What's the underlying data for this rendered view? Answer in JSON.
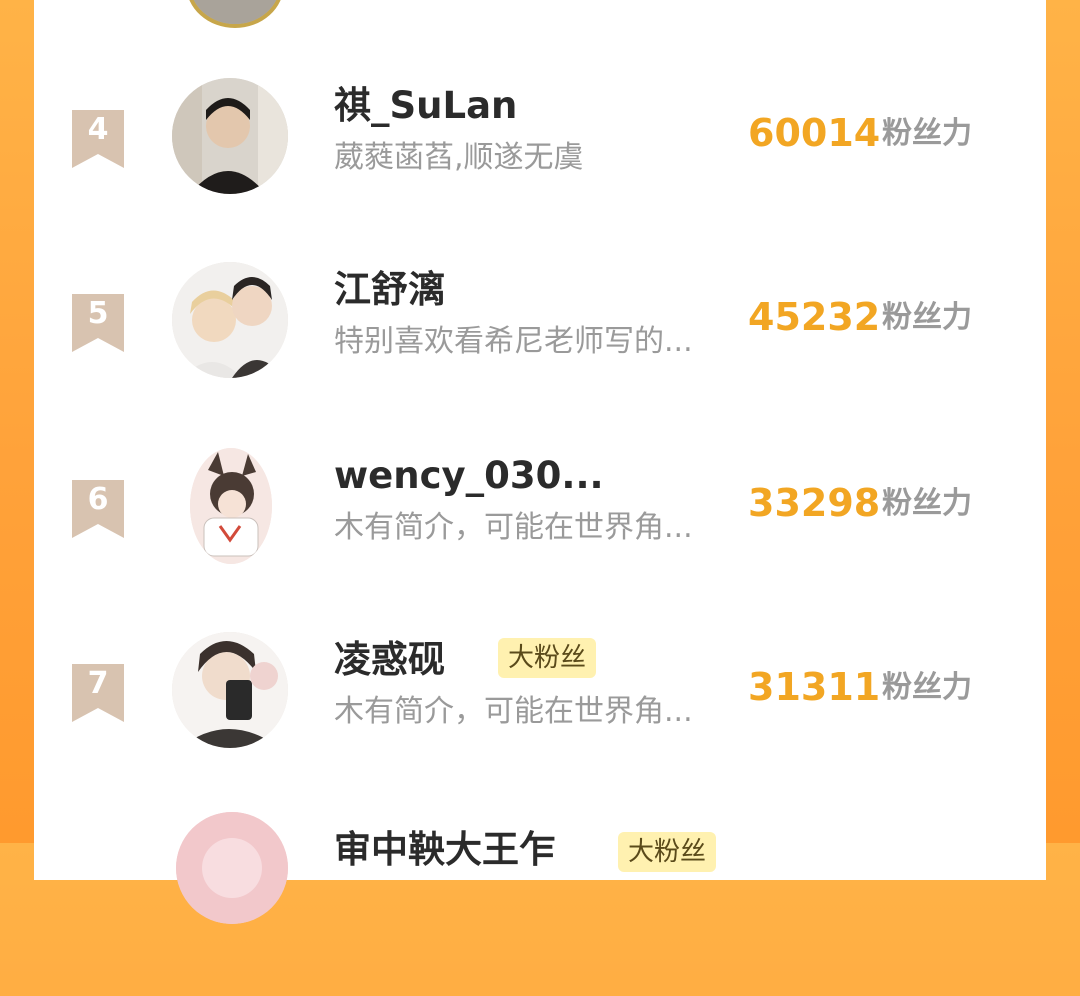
{
  "rows": [
    {
      "rank": "4",
      "name": "祺_SuLan",
      "tag": "",
      "bio": "葳蕤菡萏,顺遂无虞",
      "score": "60014",
      "unit": "粉丝力"
    },
    {
      "rank": "5",
      "name": "江舒漓",
      "tag": "",
      "bio": "特别喜欢看希尼老师写的...",
      "score": "45232",
      "unit": "粉丝力"
    },
    {
      "rank": "6",
      "name": "wency_030...",
      "tag": "",
      "bio": "木有简介，可能在世界角...",
      "score": "33298",
      "unit": "粉丝力"
    },
    {
      "rank": "7",
      "name": "凌惑砚",
      "tag": "大粉丝",
      "bio": "木有简介，可能在世界角...",
      "score": "31311",
      "unit": "粉丝力"
    },
    {
      "rank": "",
      "name": "审中鞅大王乍",
      "tag": "大粉丝",
      "bio": "",
      "score": "",
      "unit": ""
    }
  ],
  "colors": {
    "accent": "#f2a623",
    "background_orange": "#ffa23a",
    "badge": "#d8c3b0",
    "tag_bg": "#fff1b0"
  }
}
